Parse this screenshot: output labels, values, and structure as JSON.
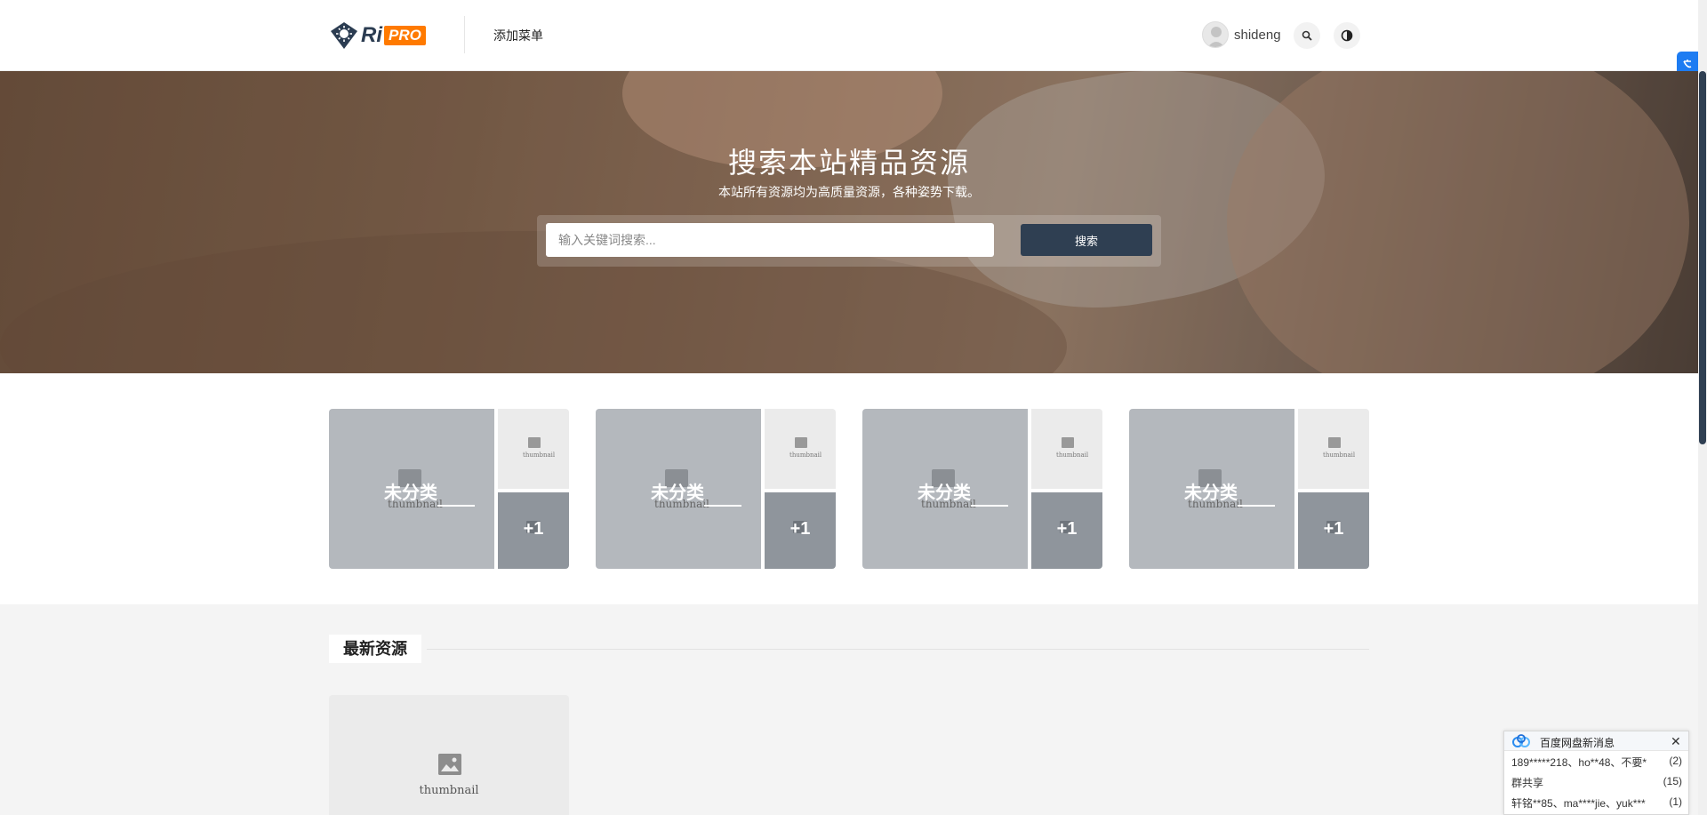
{
  "header": {
    "logo": {
      "ri": "Ri",
      "pro": "PRO"
    },
    "nav_item": "添加菜单",
    "username": "shideng",
    "search_icon": "search-icon",
    "theme_icon": "theme-toggle-icon"
  },
  "hero": {
    "title": "搜索本站精品资源",
    "subtitle": "本站所有资源均为高质量资源，各种姿势下载。",
    "search_placeholder": "输入关键词搜索...",
    "search_button": "搜索"
  },
  "categories": [
    {
      "title": "未分类",
      "count": "+1",
      "placeholder": "thumbnail",
      "placeholder_small": "thumbnail"
    },
    {
      "title": "未分类",
      "count": "+1",
      "placeholder": "thumbnail",
      "placeholder_small": "thumbnail"
    },
    {
      "title": "未分类",
      "count": "+1",
      "placeholder": "thumbnail",
      "placeholder_small": "thumbnail"
    },
    {
      "title": "未分类",
      "count": "+1",
      "placeholder": "thumbnail",
      "placeholder_small": "thumbnail"
    }
  ],
  "latest": {
    "heading": "最新资源",
    "posts": [
      {
        "placeholder": "thumbnail"
      }
    ]
  },
  "notification": {
    "title": "百度网盘新消息",
    "rows": [
      {
        "text": "189*****218、ho**48、不要*",
        "count": "(2)"
      },
      {
        "text": "群共享",
        "count": "(15)"
      },
      {
        "text": "轩铭**85、ma****jie、yuk***",
        "count": "(1)"
      }
    ]
  },
  "colors": {
    "accent": "#2f3f52",
    "logo_orange": "#ff7a00",
    "side_tab_blue": "#1d7cf2"
  }
}
